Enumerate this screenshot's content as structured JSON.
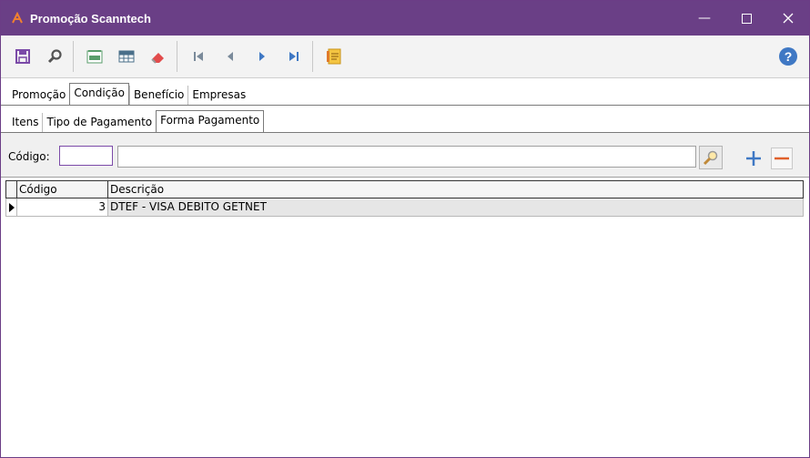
{
  "window": {
    "title": "Promoção Scanntech"
  },
  "toolbar": {
    "buttons": [
      {
        "icon": "save-icon"
      },
      {
        "icon": "search-icon"
      },
      {
        "icon": "txt-export-icon"
      },
      {
        "icon": "grid-export-icon"
      },
      {
        "icon": "eraser-icon"
      },
      {
        "icon": "first-record-icon"
      },
      {
        "icon": "previous-record-icon"
      },
      {
        "icon": "next-record-icon"
      },
      {
        "icon": "last-record-icon"
      },
      {
        "icon": "log-icon"
      }
    ],
    "help_icon": "help-icon"
  },
  "tabs_main": [
    "Promoção",
    "Condição",
    "Benefício",
    "Empresas"
  ],
  "tabs_sub": [
    "Itens",
    "Tipo de Pagamento",
    "Forma Pagamento"
  ],
  "filter": {
    "label": "Código:",
    "code_value": "",
    "desc_value": ""
  },
  "grid": {
    "columns": [
      "Código",
      "Descrição"
    ],
    "rows": [
      {
        "codigo": "3",
        "descricao": "DTEF - VISA DEBITO GETNET"
      }
    ]
  },
  "colors": {
    "titlebar": "#6a3f86",
    "accent": "#7b4aa8"
  }
}
